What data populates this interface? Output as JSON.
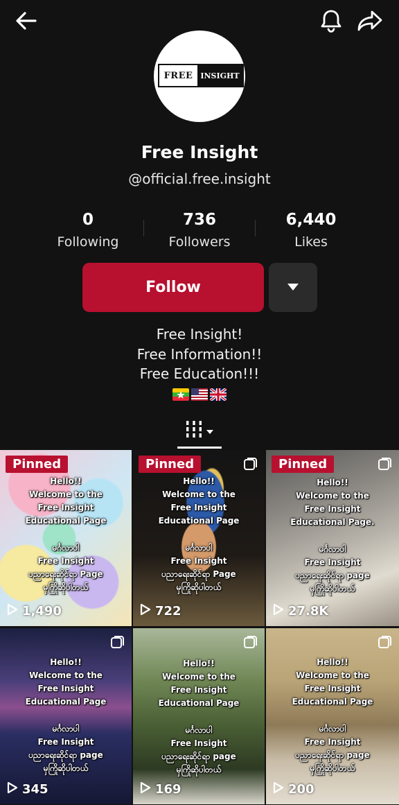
{
  "profile": {
    "logo_left": "FREE",
    "logo_right": "INSIGHT",
    "name": "Free Insight",
    "handle": "@official.free.insight"
  },
  "stats": [
    {
      "value": "0",
      "label": "Following"
    },
    {
      "value": "736",
      "label": "Followers"
    },
    {
      "value": "6,440",
      "label": "Likes"
    }
  ],
  "actions": {
    "follow_label": "Follow"
  },
  "bio": {
    "line1": "Free Insight!",
    "line2": "Free Information!!",
    "line3": "Free Education!!!"
  },
  "icons": {
    "back": "back-arrow-icon",
    "bell": "bell-icon",
    "share": "share-icon",
    "more": "caret-down-icon",
    "tab": "grid-icon"
  },
  "colors": {
    "accent": "#b8102f",
    "background": "#121212"
  },
  "videos": [
    {
      "pinned": "Pinned",
      "views": "1,490",
      "caption": [
        "Hello!!",
        "Welcome to the",
        "Free Insight",
        "Educational Page",
        "မင်္ဂလာပါ",
        "Free Insight",
        "ပညာရေးဆိုင်ရာ Page",
        "မှကြိုဆိုပါတယ်"
      ]
    },
    {
      "pinned": "Pinned",
      "views": "722",
      "caption": [
        "Hello!!",
        "Welcome to the",
        "Free Insight",
        "Educational Page",
        "မင်္ဂလာပါ",
        "Free Insight",
        "ပညာရေးဆိုင်ရာ Page",
        "မှကြိုဆိုပါတယ်"
      ]
    },
    {
      "pinned": "Pinned",
      "views": "27.8K",
      "caption": [
        "Hello!!",
        "Welcome to the",
        "Free Insight",
        "Educational Page.",
        "မင်္ဂလာပါ",
        "Free Insight",
        "ပညာရေးဆိုင်ရာ page",
        "မှကြိုဆိုပါတယ်"
      ]
    },
    {
      "pinned": "",
      "views": "345",
      "caption": [
        "Hello!!",
        "Welcome to the",
        "Free Insight",
        "Educational Page",
        "မင်္ဂလာပါ",
        "Free Insight",
        "ပညာရေးဆိုင်ရာ page",
        "မှကြိုဆိုပါတယ်"
      ]
    },
    {
      "pinned": "",
      "views": "169",
      "caption": [
        "Hello!!",
        "Welcome to the",
        "Free Insight",
        "Educational Page",
        "မင်္ဂလာပါ",
        "Free Insight",
        "ပညာရေးဆိုင်ရာ page",
        "မှကြိုဆိုပါတယ်"
      ]
    },
    {
      "pinned": "",
      "views": "200",
      "caption": [
        "Hello!!",
        "Welcome to the",
        "Free Insight",
        "Educational Page",
        "မင်္ဂလာပါ",
        "Free Insight",
        "ပညာရေးဆိုင်ရာ page",
        "မှကြိုဆိုပါတယ်"
      ]
    }
  ]
}
